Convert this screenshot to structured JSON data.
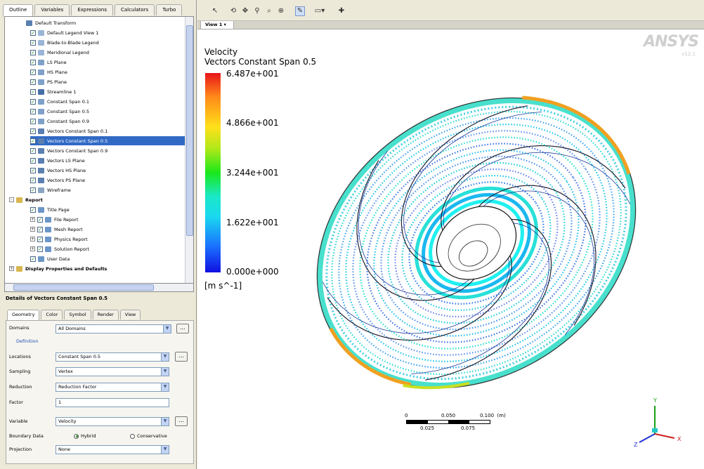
{
  "left_tabs": [
    "Outline",
    "Variables",
    "Expressions",
    "Calculators",
    "Turbo"
  ],
  "tree": [
    {
      "label": "Default Transform",
      "indent": 30,
      "icon": "vec",
      "check": false,
      "exp": "",
      "sel": false
    },
    {
      "label": "Default Legend View 1",
      "indent": 36,
      "icon": "legend",
      "check": true,
      "exp": "",
      "sel": false
    },
    {
      "label": "Blade-to-Blade Legend",
      "indent": 36,
      "icon": "legend",
      "check": true,
      "exp": "",
      "sel": false
    },
    {
      "label": "Meridional Legend",
      "indent": 36,
      "icon": "legend",
      "check": true,
      "exp": "",
      "sel": false
    },
    {
      "label": "LS Plane",
      "indent": 36,
      "icon": "plane",
      "check": true,
      "exp": "",
      "sel": false
    },
    {
      "label": "HS Plane",
      "indent": 36,
      "icon": "plane",
      "check": true,
      "exp": "",
      "sel": false
    },
    {
      "label": "PS Plane",
      "indent": 36,
      "icon": "plane",
      "check": true,
      "exp": "",
      "sel": false
    },
    {
      "label": "Streamline 1",
      "indent": 36,
      "icon": "line",
      "check": true,
      "exp": "",
      "sel": false
    },
    {
      "label": "Constant Span 0.1",
      "indent": 36,
      "icon": "plane",
      "check": true,
      "exp": "",
      "sel": false
    },
    {
      "label": "Constant Span 0.5",
      "indent": 36,
      "icon": "plane",
      "check": true,
      "exp": "",
      "sel": false
    },
    {
      "label": "Constant Span 0.9",
      "indent": 36,
      "icon": "plane",
      "check": true,
      "exp": "",
      "sel": false
    },
    {
      "label": "Vectors Constant Span 0.1",
      "indent": 36,
      "icon": "vec",
      "check": true,
      "exp": "",
      "sel": false
    },
    {
      "label": "Vectors Constant Span 0.5",
      "indent": 36,
      "icon": "vec",
      "check": true,
      "exp": "",
      "sel": true
    },
    {
      "label": "Vectors Constant Span 0.9",
      "indent": 36,
      "icon": "vec",
      "check": true,
      "exp": "",
      "sel": false
    },
    {
      "label": "Vectors LS Plane",
      "indent": 36,
      "icon": "vec",
      "check": true,
      "exp": "",
      "sel": false
    },
    {
      "label": "Vectors HS Plane",
      "indent": 36,
      "icon": "vec",
      "check": true,
      "exp": "",
      "sel": false
    },
    {
      "label": "Vectors PS Plane",
      "indent": 36,
      "icon": "vec",
      "check": true,
      "exp": "",
      "sel": false
    },
    {
      "label": "Wireframe",
      "indent": 36,
      "icon": "wire",
      "check": true,
      "exp": "",
      "sel": false
    },
    {
      "label": "Report",
      "indent": 6,
      "icon": "folder",
      "check": false,
      "exp": "-",
      "sel": false,
      "bold": true
    },
    {
      "label": "Title Page",
      "indent": 36,
      "icon": "rep",
      "check": true,
      "exp": "",
      "sel": false
    },
    {
      "label": "File Report",
      "indent": 36,
      "icon": "rep",
      "check": true,
      "exp": "+",
      "sel": false
    },
    {
      "label": "Mesh Report",
      "indent": 36,
      "icon": "rep",
      "check": true,
      "exp": "+",
      "sel": false
    },
    {
      "label": "Physics Report",
      "indent": 36,
      "icon": "rep",
      "check": true,
      "exp": "+",
      "sel": false
    },
    {
      "label": "Solution Report",
      "indent": 36,
      "icon": "rep",
      "check": true,
      "exp": "+",
      "sel": false
    },
    {
      "label": "User Data",
      "indent": 36,
      "icon": "rep",
      "check": true,
      "exp": "",
      "sel": false
    },
    {
      "label": "Display Properties and Defaults",
      "indent": 6,
      "icon": "folder",
      "check": false,
      "exp": "+",
      "sel": false,
      "bold": true
    }
  ],
  "details": {
    "title": "Details of Vectors Constant Span 0.5",
    "tabs": [
      "Geometry",
      "Color",
      "Symbol",
      "Render",
      "View"
    ],
    "domains_label": "Domains",
    "domains_value": "All Domains",
    "definition_label": "Definition",
    "locations_label": "Locations",
    "locations_value": "Constant Span 0.5",
    "sampling_label": "Sampling",
    "sampling_value": "Vertex",
    "reduction_label": "Reduction",
    "reduction_value": "Reduction Factor",
    "factor_label": "Factor",
    "factor_value": "1",
    "variable_label": "Variable",
    "variable_value": "Velocity",
    "boundary_label": "Boundary Data",
    "boundary_opt1": "Hybrid",
    "boundary_opt2": "Conservative",
    "projection_label": "Projection",
    "projection_value": "None",
    "ellipsis": "..."
  },
  "view_tab": "View 1",
  "brand": {
    "name": "ANSYS",
    "sub": "v12.1"
  },
  "legend": {
    "title": "Velocity",
    "subtitle": "Vectors Constant Span 0.5",
    "ticks": [
      "6.487e+001",
      "4.866e+001",
      "3.244e+001",
      "1.622e+001",
      "0.000e+000"
    ],
    "units": "[m s^-1]"
  },
  "scale": {
    "top": [
      "0",
      "0.050",
      "0.100  (m)"
    ],
    "bottom": [
      "0.025",
      "0.075"
    ]
  },
  "axes": {
    "x": "X",
    "y": "Y",
    "z": "Z"
  },
  "colors": {
    "selection": "#316ac5",
    "accent": "#1a70ff"
  }
}
